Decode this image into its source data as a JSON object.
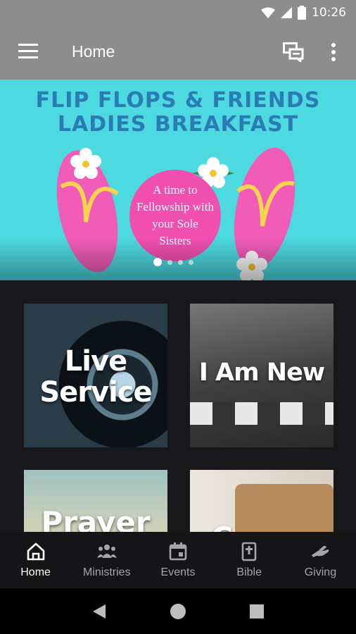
{
  "status_bar": {
    "time": "10:26"
  },
  "app_bar": {
    "title": "Home"
  },
  "banner": {
    "line1": "FLIP FLOPS & FRIENDS",
    "line2": "LADIES BREAKFAST",
    "circle_text": "A time to Fellowship with your Sole Sisters",
    "page_count": 4,
    "active_page": 1
  },
  "tiles": [
    {
      "label_line1": "Live",
      "label_line2": "Service"
    },
    {
      "label": "I Am New"
    },
    {
      "label": "Prayer"
    },
    {
      "label": "C..."
    }
  ],
  "bottom_nav": [
    {
      "label": "Home",
      "icon": "home-icon",
      "active": true
    },
    {
      "label": "Ministries",
      "icon": "people-icon",
      "active": false
    },
    {
      "label": "Events",
      "icon": "calendar-icon",
      "active": false
    },
    {
      "label": "Bible",
      "icon": "bible-icon",
      "active": false
    },
    {
      "label": "Giving",
      "icon": "giving-hand-icon",
      "active": false
    }
  ],
  "colors": {
    "app_bar": "#8d8d8d",
    "banner_bg": "#4dd9e0",
    "banner_title": "#2b7bb5",
    "circle": "#f04fb0",
    "nav_bg": "#151517"
  }
}
